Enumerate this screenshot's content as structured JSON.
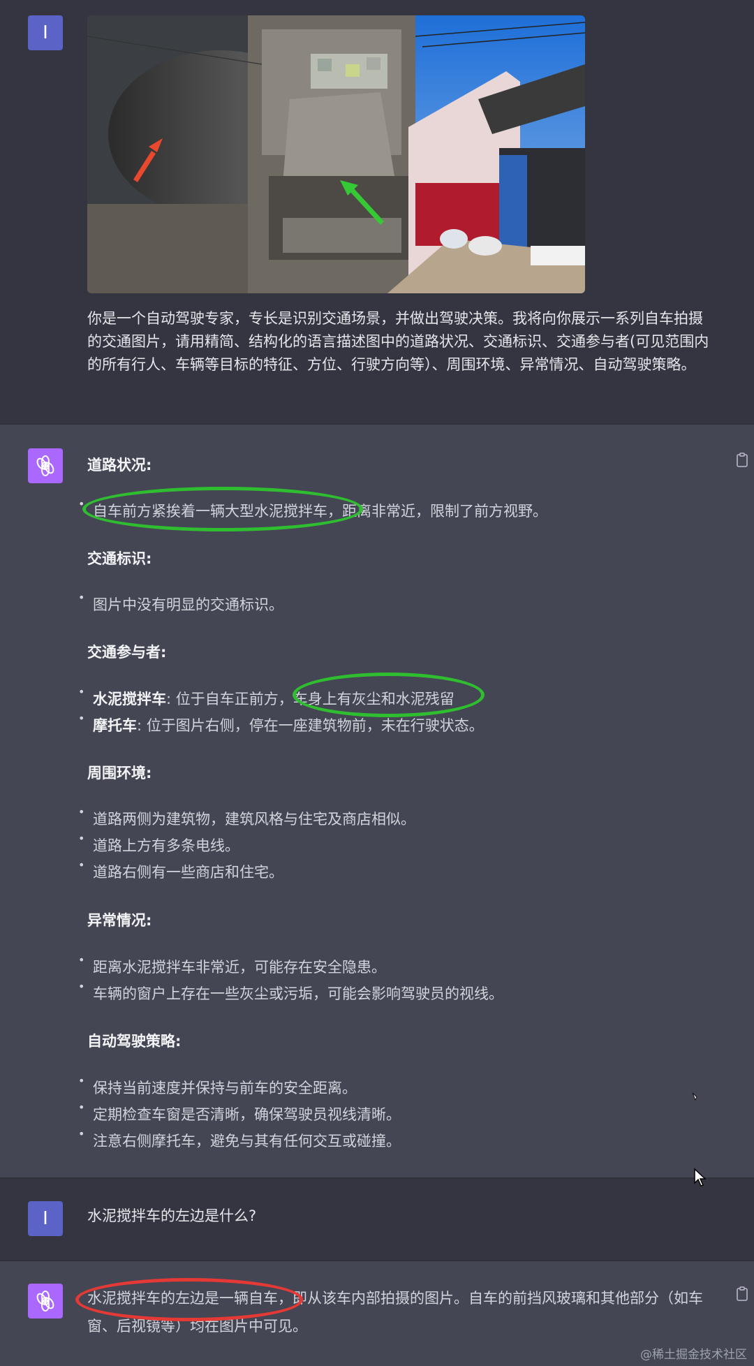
{
  "user_avatar_letter": "I",
  "prompt": "你是一个自动驾驶专家，专长是识别交通场景，并做出驾驶决策。我将向你展示一系列自车拍摄的交通图片，请用精简、结构化的语言描述图中的道路状况、交通标识、交通参与者(可见范围内的所有行人、车辆等目标的特征、方位、行驶方向等）、周围环境、异常情况、自动驾驶策略。",
  "answer": {
    "road_title": "道路状况:",
    "road_items": [
      "自车前方紧挨着一辆大型水泥搅拌车，距离非常近，限制了前方视野。"
    ],
    "sign_title": "交通标识:",
    "sign_items": [
      "图片中没有明显的交通标识。"
    ],
    "participants_title": "交通参与者:",
    "participants": [
      {
        "name": "水泥搅拌车",
        "desc": ": 位于自车正前方，车身上有灰尘和水泥残留"
      },
      {
        "name": "摩托车",
        "desc": ": 位于图片右侧，停在一座建筑物前，未在行驶状态。"
      }
    ],
    "env_title": "周围环境:",
    "env_items": [
      "道路两侧为建筑物，建筑风格与住宅及商店相似。",
      "道路上方有多条电线。",
      "道路右侧有一些商店和住宅。"
    ],
    "abnormal_title": "异常情况:",
    "abnormal_items": [
      "距离水泥搅拌车非常近，可能存在安全隐患。",
      "车辆的窗户上存在一些灰尘或污垢，可能会影响驾驶员的视线。"
    ],
    "strategy_title": "自动驾驶策略:",
    "strategy_items": [
      "保持当前速度并保持与前车的安全距离。",
      "定期检查车窗是否清晰，确保驾驶员视线清晰。",
      "注意右侧摩托车，避免与其有任何交互或碰撞。"
    ]
  },
  "question2": "水泥搅拌车的左边是什么?",
  "answer2": "水泥搅拌车的左边是一辆自车，即从该车内部拍摄的图片。自车的前挡风玻璃和其他部分（如车窗、后视镜等）均在图片中可见。",
  "watermark": "@稀土掘金技术社区",
  "colors": {
    "user_bg": "#343541",
    "bot_bg": "#444654",
    "green_circle": "#2fbe2f",
    "red_circle": "#e53935"
  }
}
